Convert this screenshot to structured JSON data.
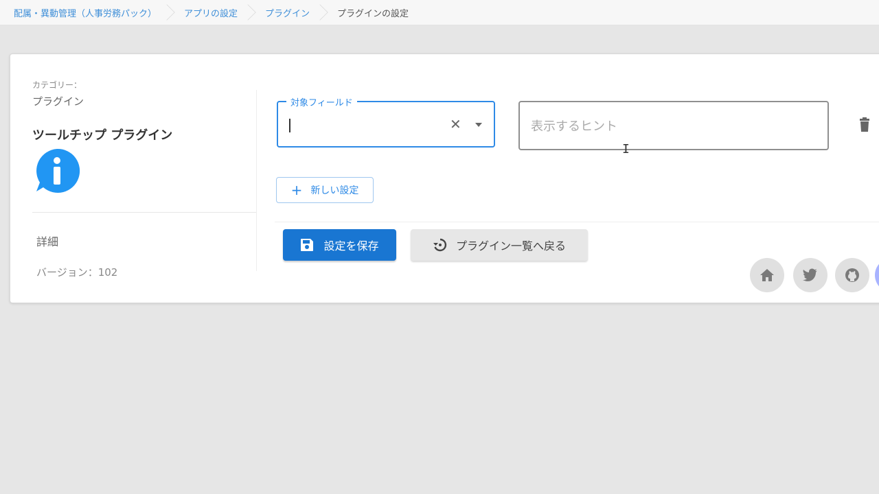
{
  "breadcrumb": {
    "items": [
      {
        "label": "配属・異動管理（人事労務パック）"
      },
      {
        "label": "アプリの設定"
      },
      {
        "label": "プラグイン"
      },
      {
        "label": "プラグインの設定"
      }
    ]
  },
  "sidebar": {
    "category_label": "カテゴリー：",
    "category_value": "プラグイン",
    "plugin_name": "ツールチップ プラグイン",
    "detail_label": "詳細",
    "version_label": "バージョン：102"
  },
  "form": {
    "target_field_label": "対象フィールド",
    "target_field_value": "",
    "hint_placeholder": "表示するヒント",
    "hint_value": "",
    "new_setting_label": "新しい設定"
  },
  "actions": {
    "save_label": "設定を保存",
    "back_label": "プラグイン一覧へ戻る"
  },
  "colors": {
    "primary": "#1976d2",
    "accent": "#2e8ae6",
    "link": "#3f8fd8",
    "icon_bg": "#e0e0e0"
  },
  "icons": {
    "info": "info-circle-icon",
    "trash": "trash-icon",
    "save": "floppy-disk-icon",
    "back": "history-icon",
    "home": "home-icon",
    "twitter": "twitter-icon",
    "github": "github-icon"
  }
}
